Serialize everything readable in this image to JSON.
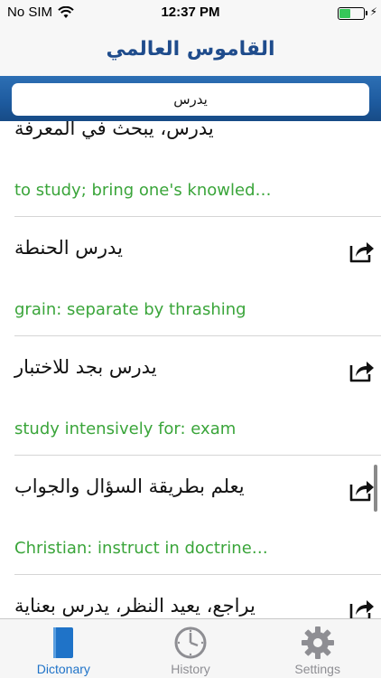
{
  "status_bar": {
    "carrier": "No SIM",
    "time": "12:37 PM"
  },
  "nav": {
    "title": "القاموس العالمي"
  },
  "search": {
    "value": "يدرس"
  },
  "results": [
    {
      "arabic": "يدرس، يبحث في المعرفة",
      "english": "to study; bring one's knowled…",
      "icon": "dash"
    },
    {
      "arabic": "يدرس الحنطة",
      "english": "grain: separate by thrashing",
      "icon": "share-icon"
    },
    {
      "arabic": "يدرس بجد للاختبار",
      "english": "study intensively for: exam",
      "icon": "share-icon"
    },
    {
      "arabic": "يعلم بطريقة السؤال والجواب",
      "english": "Christian: instruct in doctrine…",
      "icon": "share-icon"
    },
    {
      "arabic": "يراجع، يعيد النظر، يدرس بعناية",
      "english": "",
      "icon": "share-icon"
    }
  ],
  "tabs": [
    {
      "label": "Dictonary",
      "icon": "book-icon",
      "active": true
    },
    {
      "label": "History",
      "icon": "clock-icon",
      "active": false
    },
    {
      "label": "Settings",
      "icon": "gear-icon",
      "active": false
    }
  ],
  "colors": {
    "accent": "#1f73c8",
    "english_text": "#3aa53a",
    "title": "#1f4c8c",
    "search_bar": "#1d5a9e",
    "battery": "#35c759"
  }
}
